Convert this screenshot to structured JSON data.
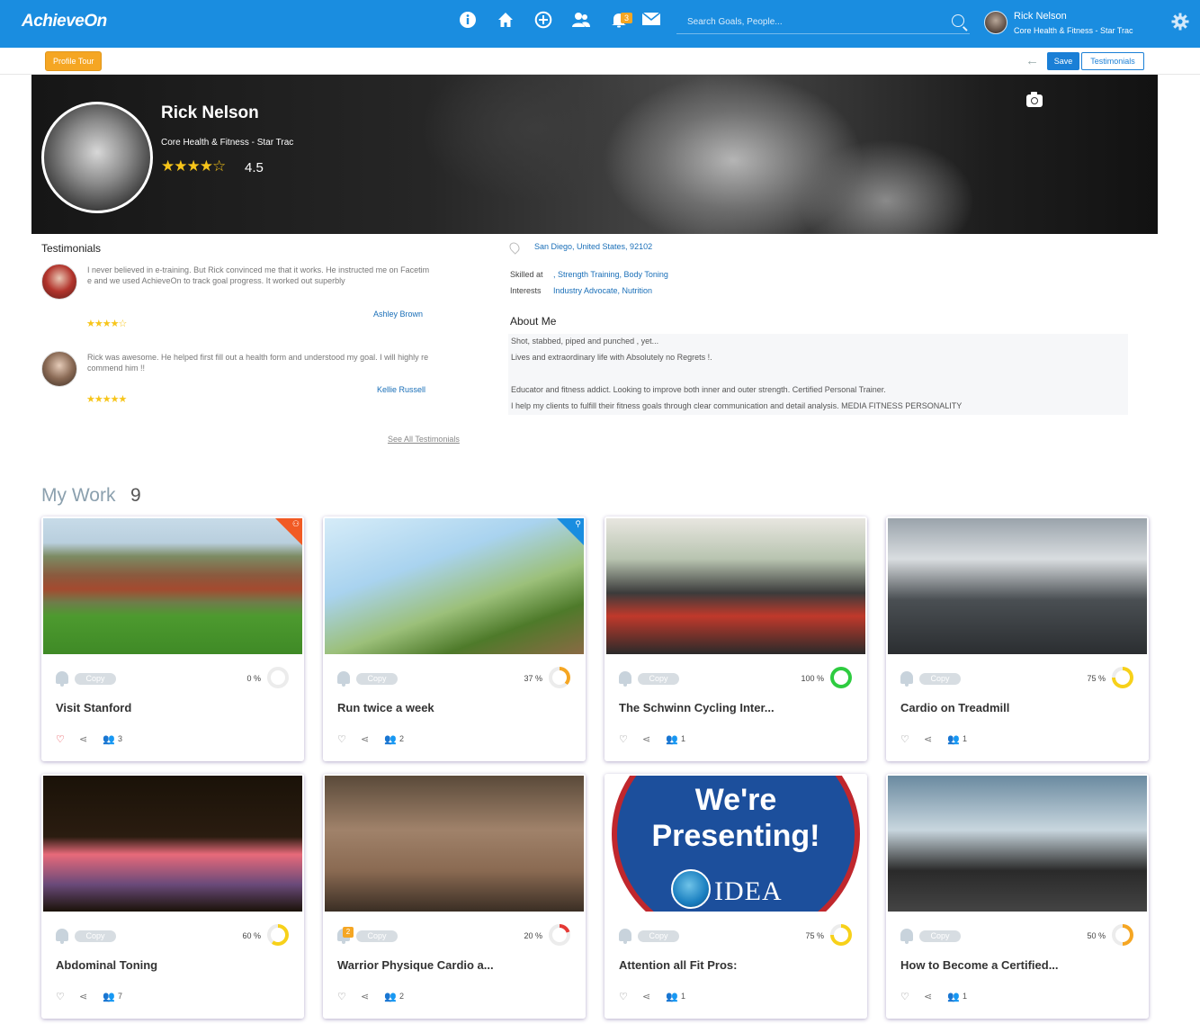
{
  "app": {
    "logo": "AchieveOn"
  },
  "topbar": {
    "notification_count": "3",
    "search_placeholder": "Search Goals, People...",
    "user_name": "Rick Nelson",
    "user_org": "Core Health & Fitness - Star Trac"
  },
  "subbar": {
    "profile_tour": "Profile Tour",
    "save": "Save",
    "testimonials": "Testimonials"
  },
  "profile": {
    "name": "Rick Nelson",
    "org": "Core Health & Fitness - Star Trac",
    "stars": "★★★★☆",
    "rating": "4.5"
  },
  "testimonials": {
    "title": "Testimonials",
    "items": [
      {
        "text": "I never believed in e-training. But Rick convinced me that it works. He instructed me on Facetime and we used AchieveOn to track goal progress. It worked out superbly",
        "author": "Ashley Brown",
        "stars": "★★★★☆",
        "rating": 4
      },
      {
        "text": "Rick was awesome. He helped first fill out a health form and understood my goal. I will highly recommend him !!",
        "author": "Kellie Russell",
        "stars": "★★★★★",
        "rating": 5
      }
    ],
    "see_all": "See All Testimonials"
  },
  "info": {
    "location": "San Diego, United States, 92102",
    "skilled_label": "Skilled at",
    "skilled_value": ", Strength Training, Body Toning",
    "interests_label": "Interests",
    "interests_value": "Industry Advocate, Nutrition",
    "about_title": "About Me",
    "about_lines": [
      "Shot, stabbed, piped and punched , yet...",
      "Lives and extraordinary life with Absolutely no Regrets !.",
      "",
      "Educator and fitness addict. Looking to improve both inner and outer strength. Certified Personal Trainer.",
      "I help my clients to fulfill their fitness goals through clear communication and detail analysis. MEDIA FITNESS PERSONALITY"
    ]
  },
  "my_work": {
    "title": "My Work",
    "count": "9",
    "copy_label": "Copy",
    "cards": [
      {
        "title": "Visit Stanford",
        "percent": "0 %",
        "progress": 0,
        "ring_color": "#e8e8e8",
        "people": "3",
        "liked": true,
        "heart": "♡",
        "share": "⋖",
        "people_icon": "👥"
      },
      {
        "title": "Run twice a week",
        "percent": "37 %",
        "progress": 37,
        "ring_color": "#f5a623",
        "people": "2",
        "liked": false,
        "heart": "♡",
        "share": "⋖",
        "people_icon": "👥"
      },
      {
        "title": "The Schwinn Cycling Inter...",
        "percent": "100 %",
        "progress": 100,
        "ring_color": "#2ecc40",
        "people": "1",
        "liked": false,
        "heart": "♡",
        "share": "⋖",
        "people_icon": "👥"
      },
      {
        "title": "Cardio on Treadmill",
        "percent": "75 %",
        "progress": 75,
        "ring_color": "#f7d11a",
        "people": "1",
        "liked": false,
        "heart": "♡",
        "share": "⋖",
        "people_icon": "👥"
      },
      {
        "title": "Abdominal Toning",
        "percent": "60 %",
        "progress": 60,
        "ring_color": "#f7d11a",
        "people": "7",
        "liked": false,
        "heart": "♡",
        "share": "⋖",
        "people_icon": "👥"
      },
      {
        "title": "Warrior Physique Cardio a...",
        "percent": "20 %",
        "progress": 20,
        "ring_color": "#e53935",
        "people": "2",
        "liked": false,
        "badge": "2",
        "heart": "♡",
        "share": "⋖",
        "people_icon": "👥"
      },
      {
        "title": "Attention all Fit Pros:",
        "percent": "75 %",
        "progress": 75,
        "ring_color": "#f7d11a",
        "people": "1",
        "liked": false,
        "heart": "♡",
        "share": "⋖",
        "people_icon": "👥",
        "image_text_1": "We're",
        "image_text_2": "Presenting!",
        "image_text_3": "IDEA"
      },
      {
        "title": "How to Become a Certified...",
        "percent": "50 %",
        "progress": 50,
        "ring_color": "#f5a623",
        "people": "1",
        "liked": false,
        "heart": "♡",
        "share": "⋖",
        "people_icon": "👥"
      }
    ]
  }
}
